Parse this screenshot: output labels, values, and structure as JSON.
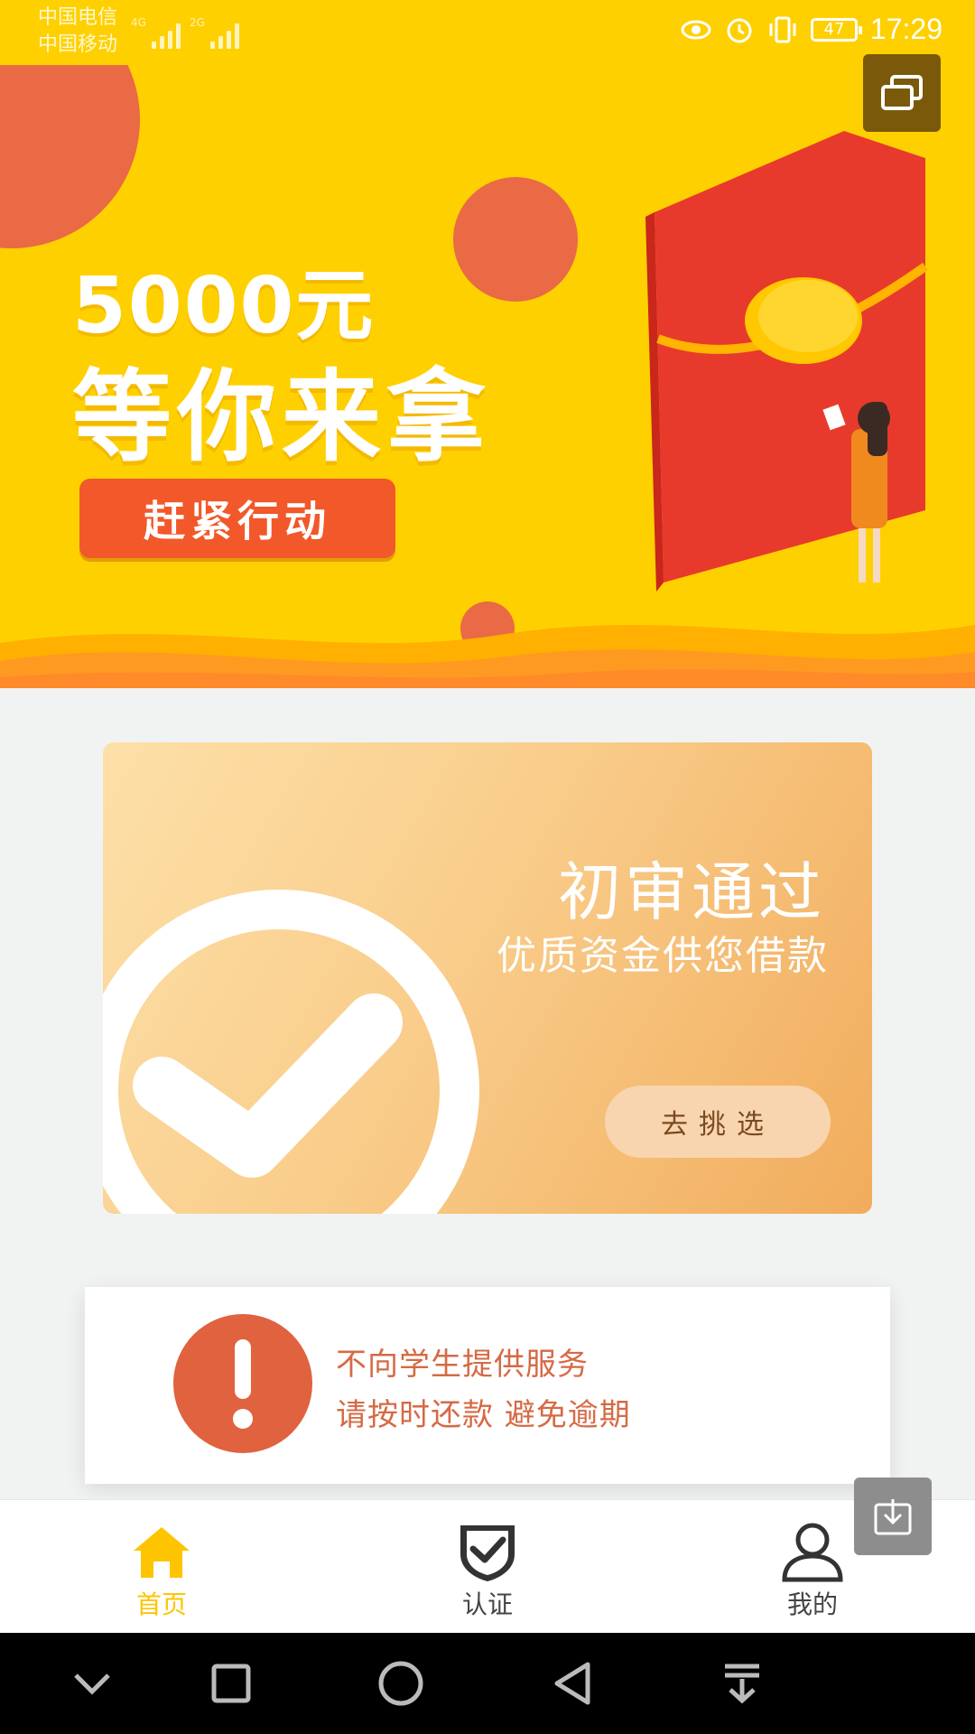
{
  "status_bar": {
    "carrier1": "中国电信",
    "carrier2": "中国移动",
    "net1": "4G",
    "net2": "2G",
    "battery": "47",
    "time": "17:29"
  },
  "banner": {
    "amount": "5000元",
    "slogan": "等你来拿",
    "cta": "赶紧行动"
  },
  "approval": {
    "title": "初审通过",
    "subtitle": "优质资金供您借款",
    "button": "去挑选"
  },
  "notice": {
    "line1": "不向学生提供服务",
    "line2": "请按时还款 避免逾期"
  },
  "tabs": {
    "home": "首页",
    "auth": "认证",
    "mine": "我的"
  },
  "colors": {
    "banner_bg": "#ffd000",
    "accent_orange": "#f2582a",
    "tab_active": "#ffc400",
    "notice_red": "#e0623f"
  }
}
